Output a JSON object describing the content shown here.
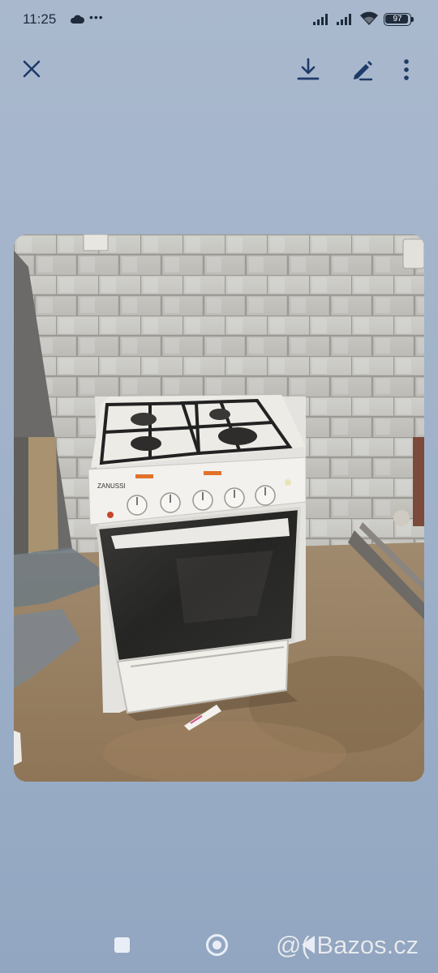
{
  "status_bar": {
    "time": "11:25",
    "more_indicator": "•••",
    "battery_percent": "97",
    "battery_level": 0.97
  },
  "toolbar": {
    "close_icon": "close-icon",
    "download_icon": "download-icon",
    "edit_icon": "pencil-icon",
    "more_icon": "more-vertical-icon"
  },
  "photo": {
    "brand_label": "ZANUSSI"
  },
  "watermark": "@( Bazos.cz",
  "colors": {
    "background": "#a9b8cd",
    "icon": "#1e3a68"
  }
}
